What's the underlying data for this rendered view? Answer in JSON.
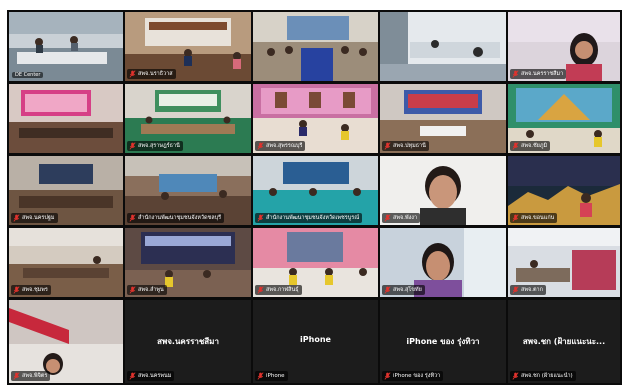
{
  "participants": [
    {
      "label": ""
    },
    {
      "label": "สพจ.นราธิวาส"
    },
    {
      "label": ""
    },
    {
      "label": ""
    },
    {
      "label": "สพจ.นครราชสีมา"
    },
    {
      "label": ""
    },
    {
      "label": "สพจ.สุราษฎร์ธานี"
    },
    {
      "label": "สพจ.สุพรรณบุรี"
    },
    {
      "label": "สพจ.ปทุมธานี"
    },
    {
      "label": "สพจ.ชัยภูมิ"
    },
    {
      "label": "สพจ.นครปฐม"
    },
    {
      "label": "สำนักงานพัฒนาชุมชนจังหวัดชลบุรี"
    },
    {
      "label": "สำนักงานพัฒนาชุมชนจังหวัดเพชรบูรณ์"
    },
    {
      "label": "สพจ.พังงา"
    },
    {
      "label": "สพจ.ขอนแก่น"
    },
    {
      "label": "สพจ.ชุมพร"
    },
    {
      "label": "สพจ.ลำพูน"
    },
    {
      "label": "สพจ.กาฬสินธุ์"
    },
    {
      "label": "สพจ.สุโขทัย"
    },
    {
      "label": "สพจ.ตาก"
    },
    {
      "label": "สพจ.พิจิตร"
    },
    {
      "label": "สพจ.นครพนม"
    },
    {
      "label": "iPhone"
    },
    {
      "label": "iPhone ของ รุ่งทิวา"
    },
    {
      "label": "สพจ.ชก (ฝ้ายแนะนำ)"
    }
  ],
  "corner_label": "DE Center",
  "text_tiles": [
    {
      "title": "สพจ.นครราชสีมา"
    },
    {
      "title": "iPhone"
    },
    {
      "title": "iPhone ของ รุ่งทิวา"
    },
    {
      "title": "สพจ.ชก (ฝ้ายแนะนะ..."
    }
  ],
  "icons": {
    "muted": "mic-muted-icon"
  },
  "colors": {
    "active_border": "#57d35c",
    "muted": "#e0322d",
    "tile_bg": "#1c1c1c"
  }
}
